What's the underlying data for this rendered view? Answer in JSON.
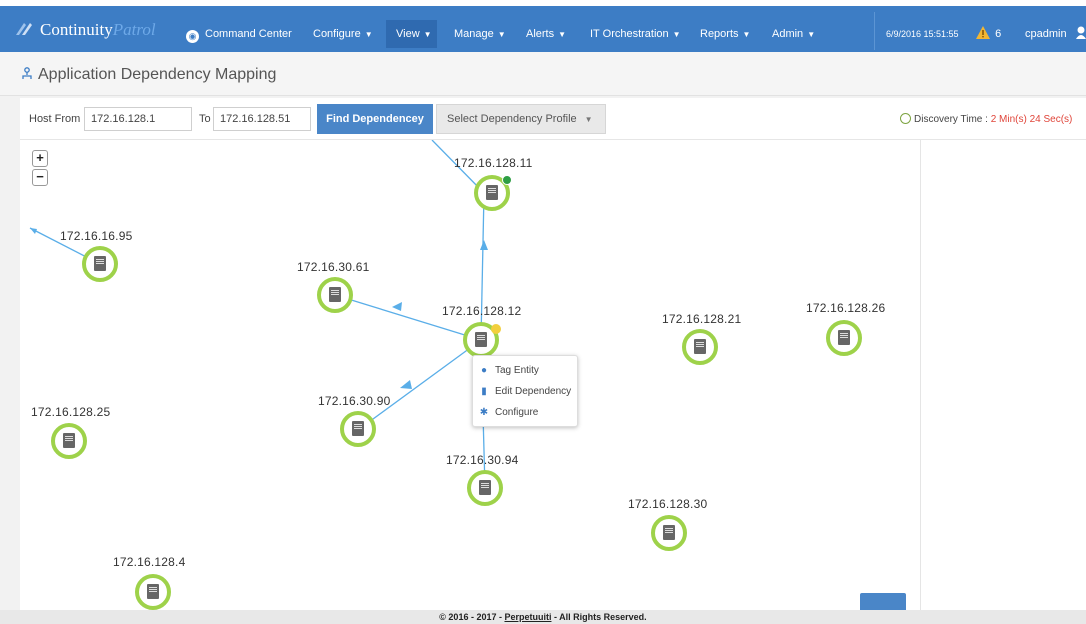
{
  "brand": {
    "name": "Continuity",
    "suffix": "Patrol"
  },
  "nav": {
    "command_center": "Command Center",
    "configure": "Configure",
    "view": "View",
    "manage": "Manage",
    "alerts": "Alerts",
    "it_orchestration": "IT Orchestration",
    "reports": "Reports",
    "admin": "Admin",
    "datetime": "6/9/2016 15:51:55",
    "alert_count": "6",
    "user": "cpadmin"
  },
  "page": {
    "title": "Application Dependency Mapping"
  },
  "toolbar": {
    "host_from_label": "Host From",
    "host_from_value": "172.16.128.1",
    "to_label": "To",
    "to_value": "172.16.128.51",
    "find_button": "Find Dependencey",
    "profile_select": "Select Dependency Profile",
    "discovery_label": "Discovery Time : ",
    "discovery_value": "2 Min(s) 24 Sec(s)"
  },
  "map": {
    "nodes": [
      {
        "id": "n1",
        "label": "172.16.128.11"
      },
      {
        "id": "n2",
        "label": "172.16.16.95"
      },
      {
        "id": "n3",
        "label": "172.16.30.61"
      },
      {
        "id": "n4",
        "label": "172.16.128.12"
      },
      {
        "id": "n5",
        "label": "172.16.128.21"
      },
      {
        "id": "n6",
        "label": "172.16.128.26"
      },
      {
        "id": "n7",
        "label": "172.16.128.25"
      },
      {
        "id": "n8",
        "label": "172.16.30.90"
      },
      {
        "id": "n9",
        "label": "172.16.30.94"
      },
      {
        "id": "n10",
        "label": "172.16.128.30"
      },
      {
        "id": "n11",
        "label": "172.16.128.4"
      }
    ],
    "context_menu": {
      "tag_entity": "Tag Entity",
      "edit_dependency": "Edit Dependency",
      "configure": "Configure"
    }
  },
  "footer": {
    "copyright": "© 2016 - 2017 - ",
    "company": "Perpetuuiti",
    "rights": " - All Rights Reserved."
  },
  "colors": {
    "nav_bg": "#3d7dc5",
    "node_ring": "#9ed24a",
    "edge": "#5aaee8",
    "accent_red": "#e0453a"
  }
}
